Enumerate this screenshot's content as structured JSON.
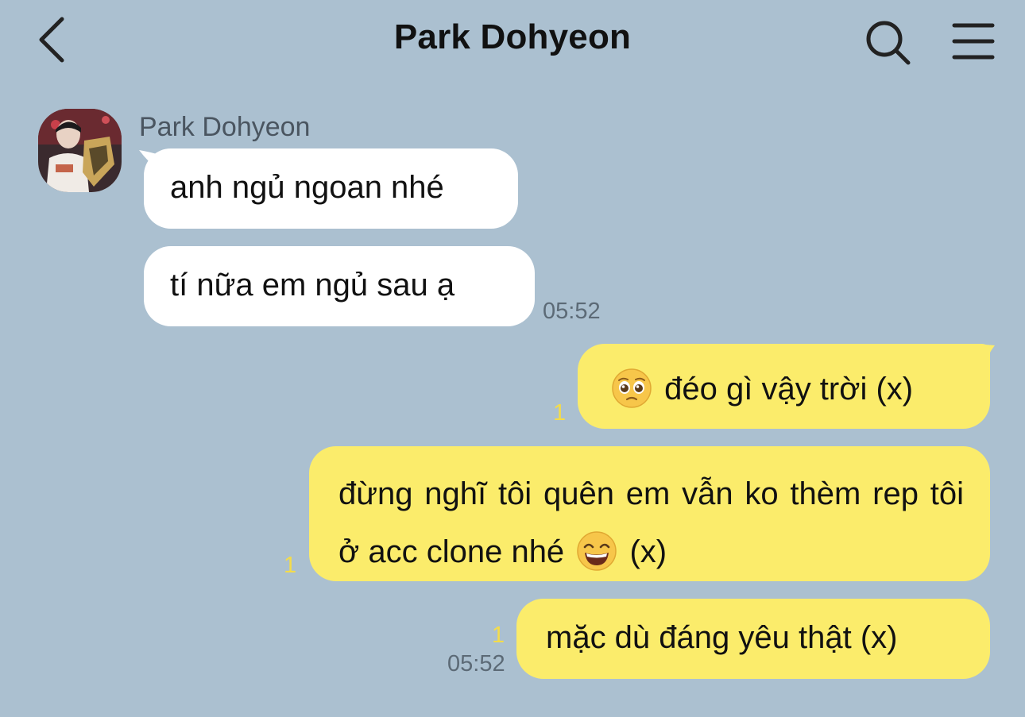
{
  "header": {
    "title": "Park Dohyeon",
    "back_icon": "chevron-left-icon",
    "search_icon": "search-icon",
    "menu_icon": "hamburger-menu-icon"
  },
  "conversation": {
    "sender_name": "Park Dohyeon",
    "incoming": [
      {
        "text": "anh ngủ ngoan nhé"
      },
      {
        "text": "tí nữa em ngủ sau ạ",
        "time": "05:52"
      }
    ],
    "outgoing": [
      {
        "pre_text": "",
        "emoji": "pleading-face-emoji",
        "text": "đéo gì vậy trời (x)",
        "unread": "1"
      },
      {
        "text": "đừng nghĩ tôi quên em vẫn ko thèm rep tôi ở acc clone nhé",
        "emoji": "grinning-face-emoji",
        "post_text": "(x)",
        "unread": "1"
      },
      {
        "text": "mặc dù đáng yêu thật (x)",
        "unread": "1",
        "time": "05:52"
      }
    ]
  },
  "colors": {
    "background": "#abc0d0",
    "incoming_bubble": "#ffffff",
    "outgoing_bubble": "#fbec6b",
    "unread_count": "#f4dc4a",
    "timestamp": "#5c6a76"
  }
}
